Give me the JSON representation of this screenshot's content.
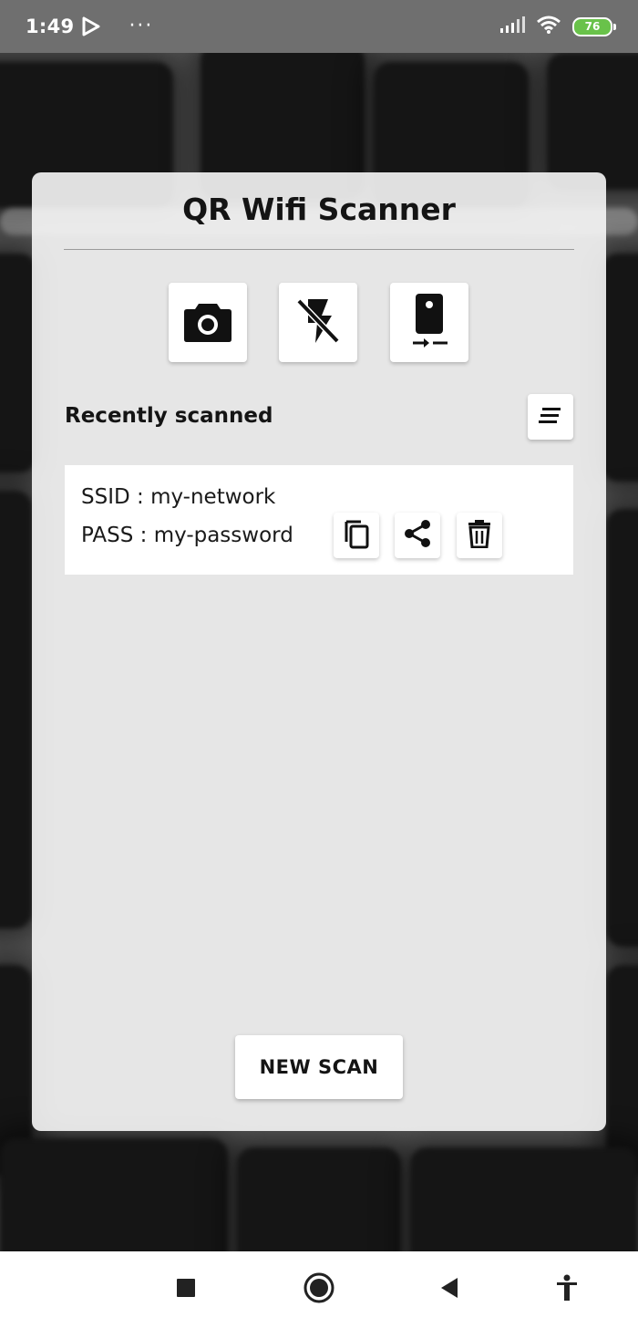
{
  "status_bar": {
    "time": "1:49",
    "more": "···",
    "battery": "76",
    "battery_color": "#69c24a"
  },
  "app": {
    "title": "QR Wifi Scanner"
  },
  "toolbar": {
    "camera_icon": "camera-icon",
    "flash_icon": "flash-off-icon",
    "switch_camera_icon": "camera-switch-icon"
  },
  "recent": {
    "label": "Recently scanned",
    "sort_icon": "sort-icon",
    "items": [
      {
        "ssid_line": "SSID : my-network",
        "pass_line": "PASS : my-password"
      }
    ]
  },
  "actions": {
    "new_scan": "NEW SCAN"
  },
  "nav": {
    "icons": [
      "stop-square-icon",
      "home-circle-icon",
      "back-triangle-icon",
      "accessibility-icon"
    ]
  }
}
